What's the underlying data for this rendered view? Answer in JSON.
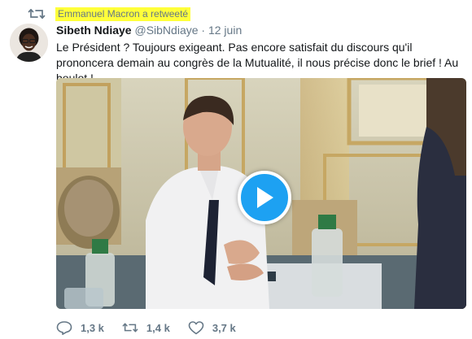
{
  "retweet": {
    "text": "Emmanuel Macron a retweeté",
    "icon": "retweet-icon",
    "highlight_color": "#ffff3a"
  },
  "tweet": {
    "author_name": "Sibeth Ndiaye",
    "handle": "@SibNdiaye",
    "separator": "·",
    "date": "12 juin",
    "text": "Le Président ? Toujours exigeant. Pas encore satisfait du discours qu'il prononcera demain au congrès de la Mutualité, il nous précise donc le brief ! Au boulot !",
    "media": {
      "type": "video",
      "play_icon": "play-icon",
      "accent_color": "#1da1f2"
    }
  },
  "actions": {
    "replies": "1,3 k",
    "retweets": "1,4 k",
    "likes": "3,7 k"
  }
}
